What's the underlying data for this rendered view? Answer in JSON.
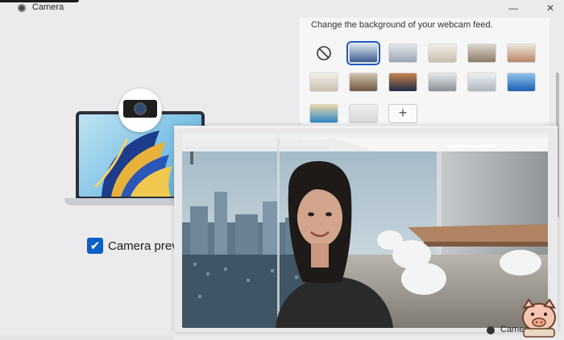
{
  "window": {
    "title": "Camera",
    "minimize": "—",
    "close": "✕"
  },
  "left_pane": {
    "camera_preview_label": "Camera prev",
    "checkbox_glyph": "✔"
  },
  "background_panel": {
    "caption": "Change the background of your webcam feed.",
    "thumbnails": [
      {
        "name": "none",
        "selected": false
      },
      {
        "name": "office-blue",
        "selected": true,
        "colors": [
          "#3b5a8c",
          "#d9e4ee"
        ]
      },
      {
        "name": "city-window",
        "selected": false,
        "colors": [
          "#9aa5b2",
          "#e1e6ea"
        ]
      },
      {
        "name": "living-room",
        "selected": false,
        "colors": [
          "#c9bfae",
          "#f2eee6"
        ]
      },
      {
        "name": "office-wood",
        "selected": false,
        "colors": [
          "#8c7a66",
          "#dcd6cc"
        ]
      },
      {
        "name": "room-warm",
        "selected": false,
        "colors": [
          "#b8866a",
          "#efe6da"
        ]
      },
      {
        "name": "room-bright",
        "selected": false,
        "colors": [
          "#cbbfb0",
          "#f4efe8"
        ]
      },
      {
        "name": "library",
        "selected": false,
        "colors": [
          "#6e5642",
          "#d1c3b0"
        ]
      },
      {
        "name": "night-city",
        "selected": false,
        "colors": [
          "#1d2c48",
          "#c9814a"
        ]
      },
      {
        "name": "abstract-silver",
        "selected": false,
        "colors": [
          "#8a8f96",
          "#e6e8ea"
        ]
      },
      {
        "name": "mountain-ink",
        "selected": false,
        "colors": [
          "#aeb6bd",
          "#eef1f2"
        ]
      },
      {
        "name": "blue-wave",
        "selected": false,
        "colors": [
          "#1d5fb3",
          "#8fc3ea"
        ]
      },
      {
        "name": "beach",
        "selected": false,
        "colors": [
          "#2b86c8",
          "#e8d7a8"
        ]
      },
      {
        "name": "blur",
        "selected": false,
        "colors": [
          "#d6d6d6",
          "#efefef"
        ]
      }
    ],
    "add_glyph": "+"
  },
  "camera_window": {
    "footer_label": "Camera"
  },
  "colors": {
    "accent": "#0a5fc8",
    "selection": "#1a58c4"
  }
}
